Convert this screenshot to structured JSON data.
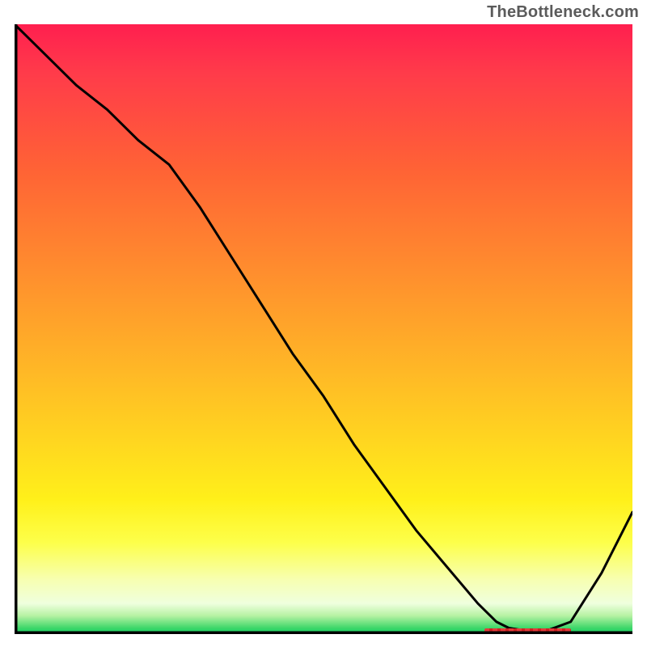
{
  "attribution": "TheBottleneck.com",
  "colors": {
    "curve": "#000000",
    "axis": "#000000",
    "marker": "#e23a3a"
  },
  "chart_data": {
    "type": "line",
    "title": "",
    "xlabel": "",
    "ylabel": "",
    "xlim": [
      0,
      100
    ],
    "ylim": [
      0,
      100
    ],
    "grid": false,
    "series": [
      {
        "name": "bottleneck-curve",
        "x": [
          0,
          5,
          10,
          15,
          20,
          25,
          30,
          35,
          40,
          45,
          50,
          55,
          60,
          65,
          70,
          75,
          78,
          80,
          83,
          86,
          90,
          95,
          100
        ],
        "y": [
          100,
          95,
          90,
          86,
          81,
          77,
          70,
          62,
          54,
          46,
          39,
          31,
          24,
          17,
          11,
          5,
          2,
          1,
          0.5,
          0.5,
          2,
          10,
          20
        ]
      }
    ],
    "annotations": [
      {
        "name": "optimum-band",
        "x_start": 76,
        "x_end": 90,
        "y": 0.5
      }
    ]
  }
}
